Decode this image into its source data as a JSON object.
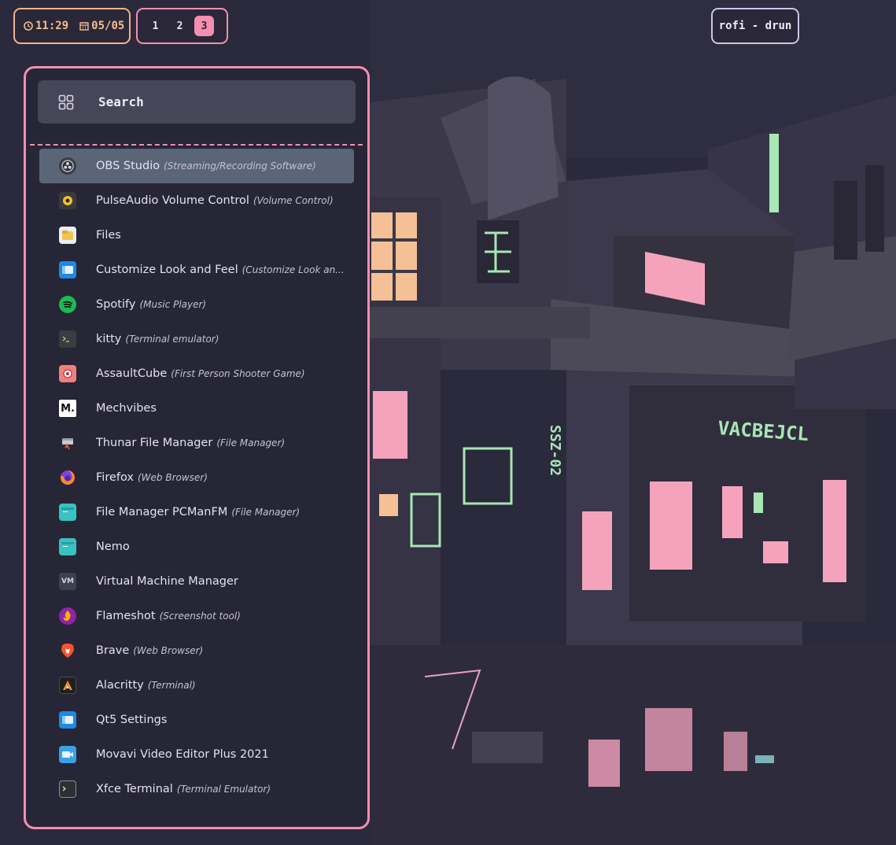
{
  "topbar": {
    "time": "11:29",
    "date": "05/05",
    "workspaces": [
      "1",
      "2",
      "3"
    ],
    "active_workspace": "3",
    "window_title": "rofi - drun"
  },
  "rofi": {
    "prompt": "Search",
    "entries": [
      {
        "name": "OBS Studio",
        "desc": "(Streaming/Recording Software)",
        "icon": "obs-icon",
        "selected": true
      },
      {
        "name": "PulseAudio Volume Control",
        "desc": "(Volume Control)",
        "icon": "pulseaudio-icon"
      },
      {
        "name": "Files",
        "desc": "",
        "icon": "files-icon"
      },
      {
        "name": "Customize Look and Feel",
        "desc": "(Customize Look an...",
        "icon": "customize-icon"
      },
      {
        "name": "Spotify",
        "desc": "(Music Player)",
        "icon": "spotify-icon"
      },
      {
        "name": "kitty",
        "desc": "(Terminal emulator)",
        "icon": "kitty-icon"
      },
      {
        "name": "AssaultCube",
        "desc": "(First Person Shooter Game)",
        "icon": "assaultcube-icon"
      },
      {
        "name": "Mechvibes",
        "desc": "",
        "icon": "mechvibes-icon"
      },
      {
        "name": "Thunar File Manager",
        "desc": "(File Manager)",
        "icon": "thunar-icon"
      },
      {
        "name": "Firefox",
        "desc": "(Web Browser)",
        "icon": "firefox-icon"
      },
      {
        "name": "File Manager PCManFM",
        "desc": "(File Manager)",
        "icon": "pcmanfm-icon"
      },
      {
        "name": "Nemo",
        "desc": "",
        "icon": "nemo-icon"
      },
      {
        "name": "Virtual Machine Manager",
        "desc": "",
        "icon": "virt-manager-icon"
      },
      {
        "name": "Flameshot",
        "desc": "(Screenshot tool)",
        "icon": "flameshot-icon"
      },
      {
        "name": "Brave",
        "desc": "(Web Browser)",
        "icon": "brave-icon"
      },
      {
        "name": "Alacritty",
        "desc": "(Terminal)",
        "icon": "alacritty-icon"
      },
      {
        "name": "Qt5 Settings",
        "desc": "",
        "icon": "qt5-settings-icon"
      },
      {
        "name": "Movavi Video Editor Plus 2021",
        "desc": "",
        "icon": "movavi-icon"
      },
      {
        "name": "Xfce Terminal",
        "desc": "(Terminal Emulator)",
        "icon": "xfce-terminal-icon"
      }
    ]
  },
  "wallpaper": {
    "neon_signs": [
      "VACBEJCL",
      "SSZ-02"
    ]
  },
  "colors": {
    "accent_pink": "#f48fb1",
    "accent_peach": "#f0b48a",
    "neon_green": "#a8e6b4",
    "selected_row": "#5a6578",
    "panel_bg": "#272636"
  }
}
